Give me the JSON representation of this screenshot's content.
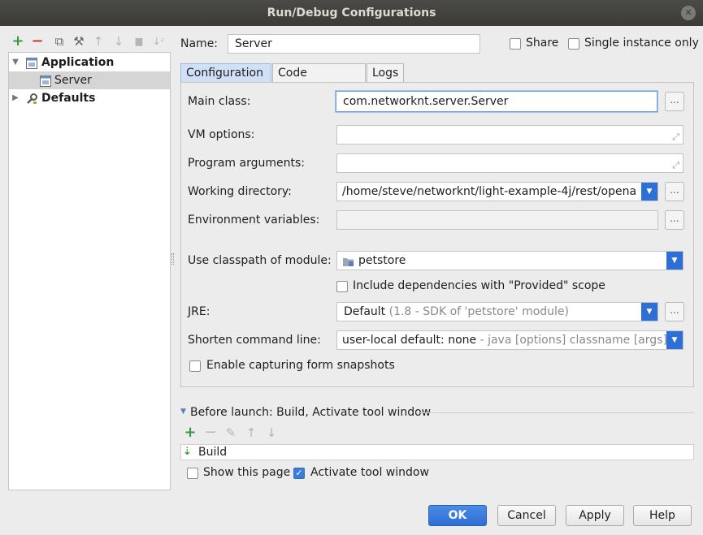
{
  "window": {
    "title": "Run/Debug Configurations",
    "close_glyph": "✕"
  },
  "toolbar": {
    "add_glyph": "+",
    "remove_glyph": "−",
    "copy_glyph": "⧉",
    "wrench_glyph": "⚒",
    "up_glyph": "↑",
    "down_glyph": "↓",
    "folder_glyph": "▆",
    "sort_glyph": "↓ᶻ"
  },
  "tree": {
    "application_label": "Application",
    "server_label": "Server",
    "defaults_label": "Defaults",
    "expanded_glyph": "▼",
    "collapsed_glyph": "▶"
  },
  "header": {
    "name_label": "Name:",
    "name_value": "Server",
    "share_label": "Share",
    "single_instance_label": "Single instance only"
  },
  "tabs": [
    {
      "label": "Configuration"
    },
    {
      "label": "Code Coverage"
    },
    {
      "label": "Logs"
    }
  ],
  "form": {
    "main_class_label": "Main class:",
    "main_class_value": "com.networknt.server.Server",
    "vm_options_label": "VM options:",
    "vm_options_value": "",
    "program_args_label": "Program arguments:",
    "program_args_value": "",
    "working_dir_label": "Working directory:",
    "working_dir_value": "/home/steve/networknt/light-example-4j/rest/opena",
    "env_vars_label": "Environment variables:",
    "env_vars_value": "",
    "classpath_label": "Use classpath of module:",
    "classpath_value": "petstore",
    "include_deps_label": "Include dependencies with \"Provided\" scope",
    "jre_label": "JRE:",
    "jre_value": "Default",
    "jre_hint": "(1.8 - SDK of 'petstore' module)",
    "shorten_label": "Shorten command line:",
    "shorten_value": "user-local default: none",
    "shorten_hint": "- java [options] classname [args]",
    "enable_snapshots_label": "Enable capturing form snapshots",
    "dots": "...",
    "expand_glyph": "⤢",
    "combo_arrow": "▼"
  },
  "before_launch": {
    "title": "Before launch: Build, Activate tool window",
    "build_label": "Build",
    "show_page_label": "Show this page",
    "activate_label": "Activate tool window",
    "add_glyph": "+",
    "remove_glyph": "−",
    "edit_glyph": "✎",
    "up_glyph": "↑",
    "down_glyph": "↓",
    "build_glyph": "⇣",
    "check_glyph": "✓"
  },
  "buttons": {
    "ok": "OK",
    "cancel": "Cancel",
    "apply": "Apply",
    "help": "Help"
  },
  "colors": {
    "accent": "#2d6fd6",
    "add_green": "#3a9a3a",
    "remove_red": "#c83c3c"
  }
}
